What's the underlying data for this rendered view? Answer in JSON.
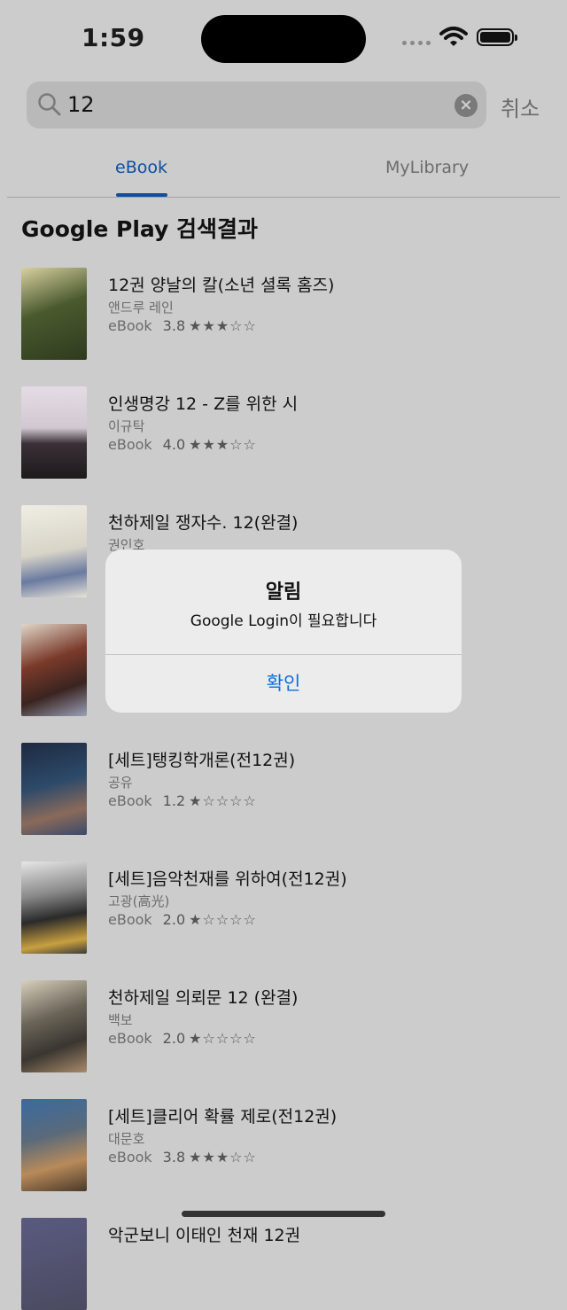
{
  "status_bar": {
    "time": "1:59"
  },
  "search": {
    "query": "12",
    "cancel_label": "취소"
  },
  "tabs": [
    {
      "label": "eBook"
    },
    {
      "label": "MyLibrary"
    }
  ],
  "section_title": "Google Play 검색결과",
  "books": [
    {
      "title": "12권 양날의 칼(소년 셜록 홈즈)",
      "author": "앤드루 레인",
      "format": "eBook",
      "rating": "3.8",
      "stars": "★★★☆☆"
    },
    {
      "title": "인생명강 12 - Z를 위한 시",
      "author": "이규탁",
      "format": "eBook",
      "rating": "4.0",
      "stars": "★★★☆☆"
    },
    {
      "title": "천하제일 쟁자수. 12(완결)",
      "author": "권인호",
      "format": "",
      "rating": "",
      "stars": ""
    },
    {
      "title": "",
      "author": "",
      "format": "",
      "rating": "",
      "stars": ""
    },
    {
      "title": "[세트]탱킹학개론(전12권)",
      "author": "공유",
      "format": "eBook",
      "rating": "1.2",
      "stars": "★☆☆☆☆"
    },
    {
      "title": "[세트]음악천재를 위하여(전12권)",
      "author": "고광(高光)",
      "format": "eBook",
      "rating": "2.0",
      "stars": "★☆☆☆☆"
    },
    {
      "title": "천하제일 의뢰문 12 (완결)",
      "author": "백보",
      "format": "eBook",
      "rating": "2.0",
      "stars": "★☆☆☆☆"
    },
    {
      "title": "[세트]클리어 확률 제로(전12권)",
      "author": "대문호",
      "format": "eBook",
      "rating": "3.8",
      "stars": "★★★☆☆"
    },
    {
      "title": "악군보니 이태인 천재 12권",
      "author": "",
      "format": "",
      "rating": "",
      "stars": ""
    }
  ],
  "cover_colors": [
    "#4a5a2e",
    "#d9cfd8",
    "#e9e6dc",
    "#7a3a2a",
    "#2d4a6a",
    "#3a3a3a",
    "#6a6458",
    "#5a6a7a",
    "#4a4a60"
  ],
  "dialog": {
    "title": "알림",
    "message": "Google Login이 필요합니다",
    "confirm_label": "확인"
  },
  "colors": {
    "accent": "#0d4fa0",
    "dialog_button": "#0a6fdb",
    "overlay": "#cccccc"
  }
}
